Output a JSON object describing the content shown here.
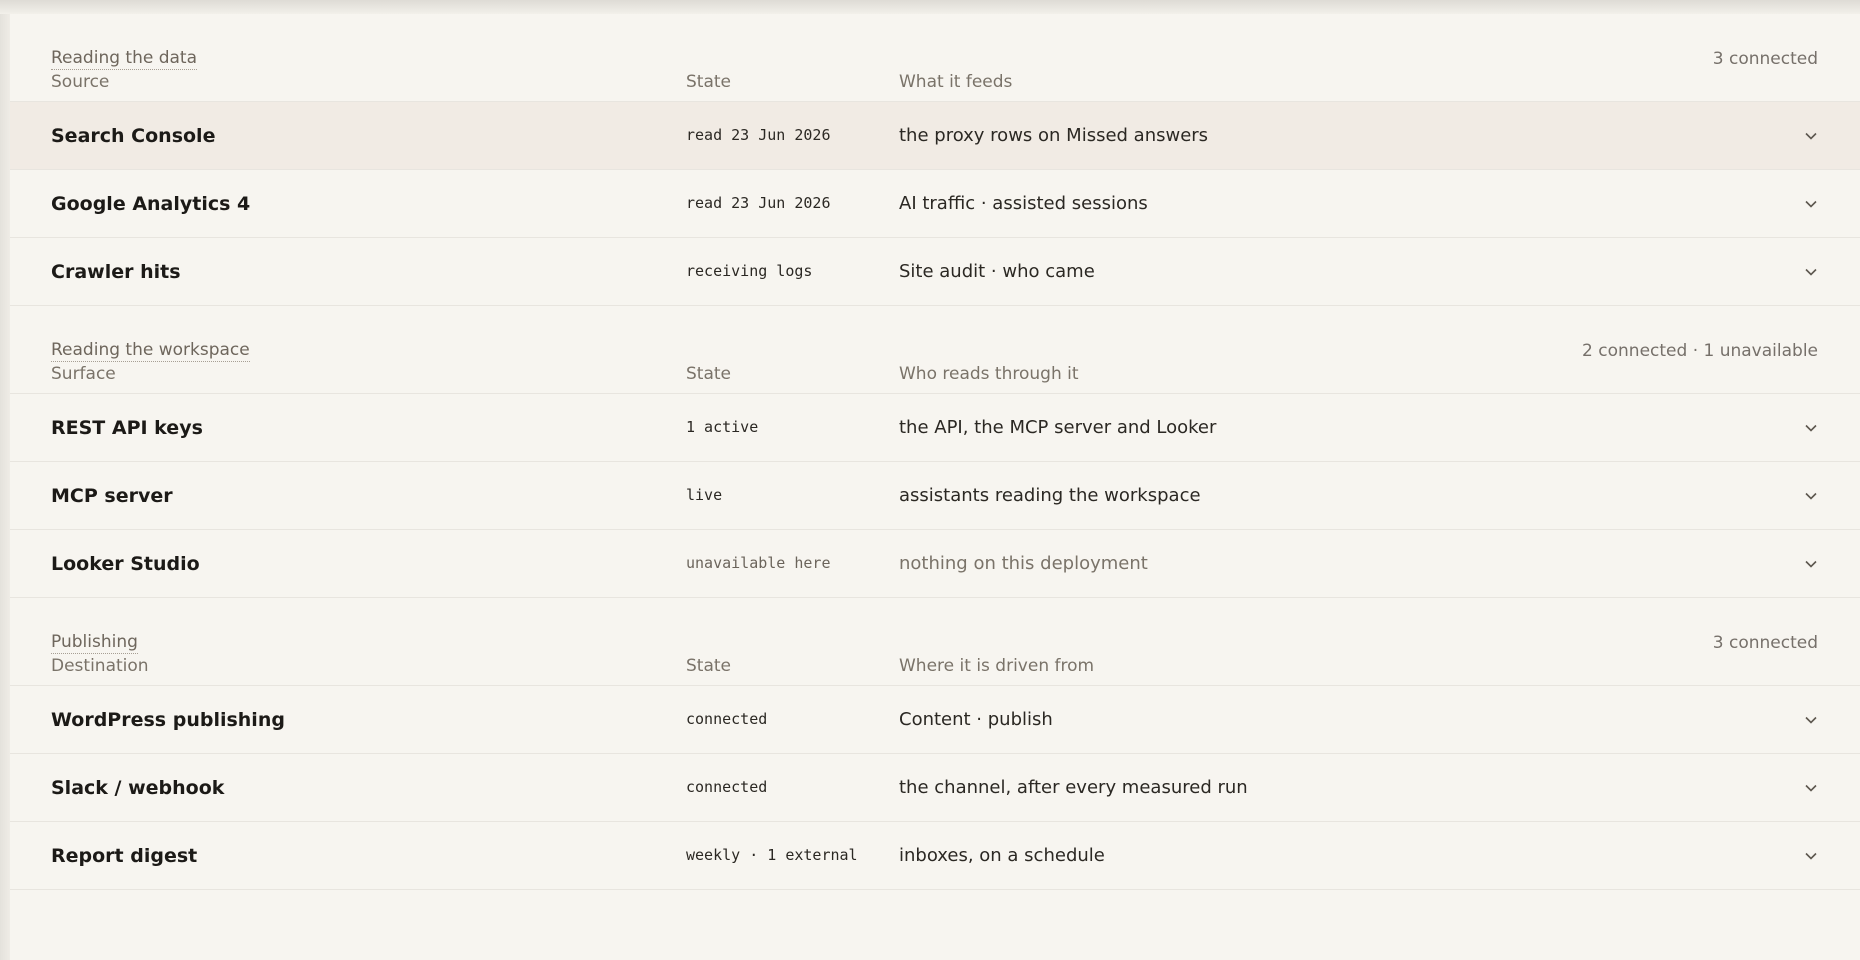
{
  "sections": [
    {
      "title": "Reading the data",
      "count": "3 connected",
      "columns": [
        "Source",
        "State",
        "What it feeds"
      ],
      "rows": [
        {
          "name": "Search Console",
          "state": "read 23 Jun 2026",
          "feeds": "the proxy rows on Missed answers"
        },
        {
          "name": "Google Analytics 4",
          "state": "read 23 Jun 2026",
          "feeds": "AI traffic · assisted sessions"
        },
        {
          "name": "Crawler hits",
          "state": "receiving logs",
          "feeds": "Site audit · who came"
        }
      ]
    },
    {
      "title": "Reading the workspace",
      "count": "2 connected · 1 unavailable",
      "columns": [
        "Surface",
        "State",
        "Who reads through it"
      ],
      "rows": [
        {
          "name": "REST API keys",
          "state": "1 active",
          "feeds": "the API, the MCP server and Looker"
        },
        {
          "name": "MCP server",
          "state": "live",
          "feeds": "assistants reading the workspace"
        },
        {
          "name": "Looker Studio",
          "state": "unavailable here",
          "feeds": "nothing on this deployment"
        }
      ]
    },
    {
      "title": "Publishing",
      "count": "3 connected",
      "columns": [
        "Destination",
        "State",
        "Where it is driven from"
      ],
      "rows": [
        {
          "name": "WordPress publishing",
          "state": "connected",
          "feeds": "Content · publish"
        },
        {
          "name": "Slack / webhook",
          "state": "connected",
          "feeds": "the channel, after every measured run"
        },
        {
          "name": "Report digest",
          "state": "weekly · 1 external",
          "feeds": "inboxes, on a schedule"
        }
      ]
    }
  ],
  "icons": {
    "row_toggle": "chevron-down-icon"
  },
  "colors": {
    "background": "#f7f5f0",
    "highlight_row": "#f1ebe4",
    "muted_text": "#7a7369"
  }
}
